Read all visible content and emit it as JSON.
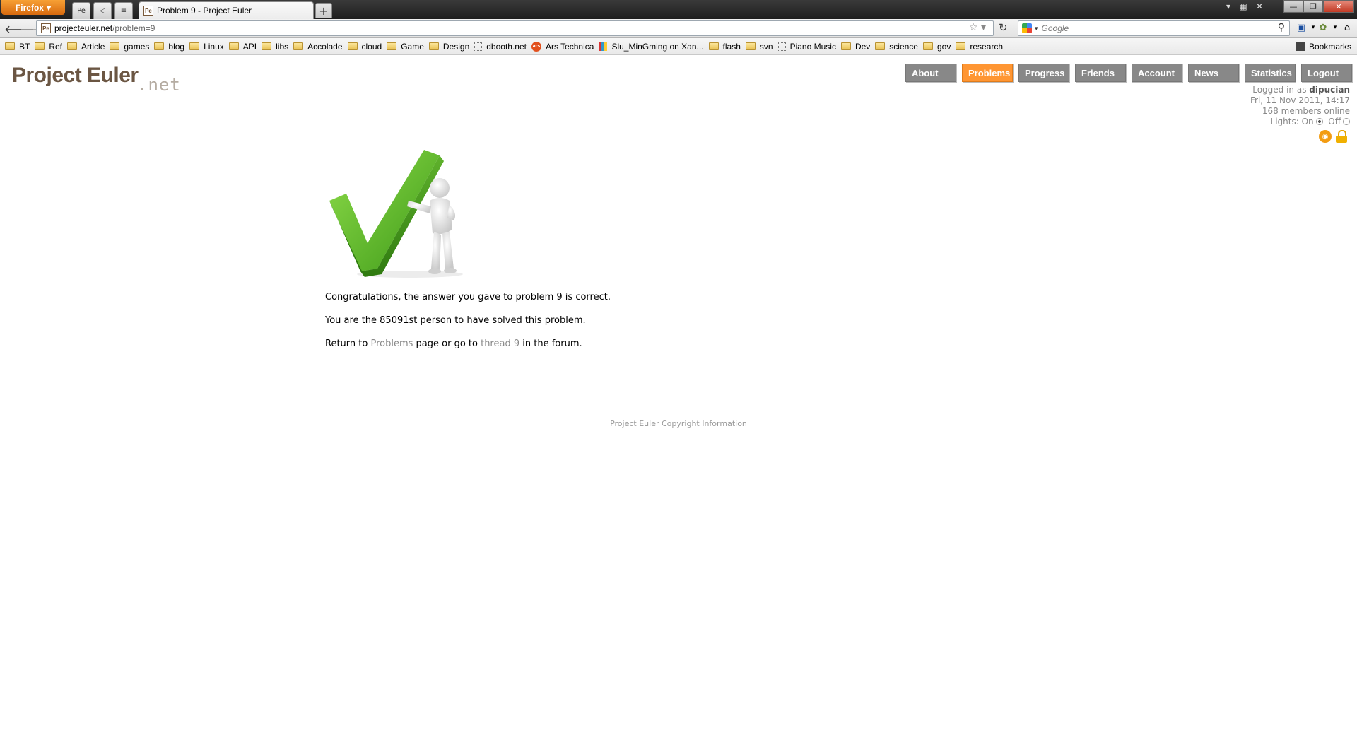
{
  "browser": {
    "app_button": "Firefox",
    "active_tab_title": "Problem 9 - Project Euler",
    "tab_favicon": "Pe",
    "url_host": "projecteuler.net",
    "url_path": "/problem=9",
    "search_placeholder": "Google",
    "bookmarks": [
      "BT",
      "Ref",
      "Article",
      "games",
      "blog",
      "Linux",
      "API",
      "libs",
      "Accolade",
      "cloud",
      "Game",
      "Design",
      "dbooth.net",
      "Ars Technica",
      "Slu_MinGming on Xan...",
      "flash",
      "svn",
      "Piano Music",
      "Dev",
      "science",
      "gov",
      "research"
    ],
    "bookmarks_menu": "Bookmarks"
  },
  "site": {
    "logo_main": "Project Euler",
    "logo_suffix": ".net",
    "nav": [
      "About",
      "Problems",
      "Progress",
      "Friends",
      "Account",
      "News",
      "Statistics",
      "Logout"
    ],
    "active_nav": "Problems",
    "logged_in_prefix": "Logged in as",
    "username": "dipucian",
    "datetime": "Fri, 11 Nov 2011, 14:17",
    "members_online": "168 members online",
    "lights_label": "Lights: On",
    "lights_off": "Off"
  },
  "message": {
    "line1": "Congratulations, the answer you gave to problem 9 is correct.",
    "line2": "You are the 85091st person to have solved this problem.",
    "line3_prefix": "Return to",
    "line3_link1": "Problems",
    "line3_mid": "page or go to",
    "line3_link2": "thread 9",
    "line3_suffix": "in the forum."
  },
  "footer": {
    "copyright": "Project Euler Copyright Information"
  },
  "colors": {
    "active_nav": "#ff9633",
    "nav": "#888888",
    "logo": "#6b5643",
    "check_green": "#5cb82a"
  }
}
